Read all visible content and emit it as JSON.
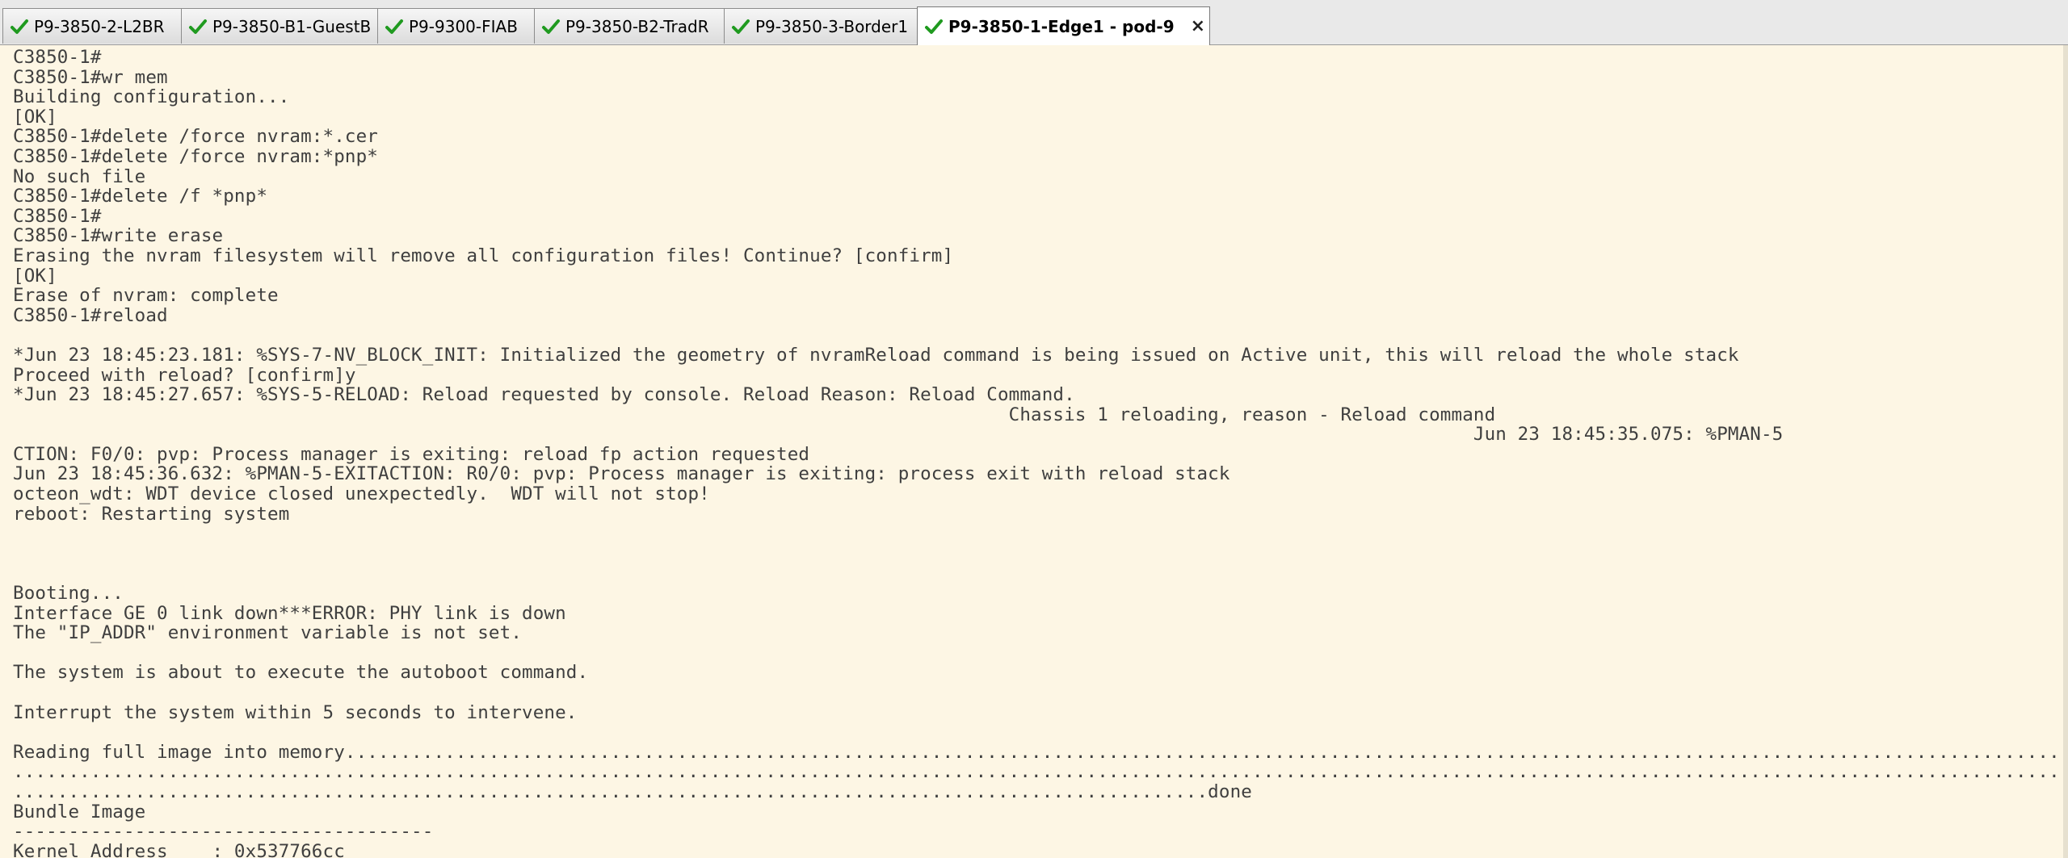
{
  "tabs": [
    {
      "label": "P9-3850-2-L2BR",
      "active": false
    },
    {
      "label": "P9-3850-B1-GuestB",
      "active": false
    },
    {
      "label": "P9-9300-FIAB",
      "active": false
    },
    {
      "label": "P9-3850-B2-TradR",
      "active": false
    },
    {
      "label": "P9-3850-3-Border1",
      "active": false
    },
    {
      "label": "P9-3850-1-Edge1 - pod-9",
      "active": true
    }
  ],
  "close_icon": "×",
  "colors": {
    "terminal_bg": "#fdf6e4",
    "terminal_text": "#3f3f3f",
    "check_green": "#1f9a1f"
  },
  "terminal": {
    "lines": [
      "C3850-1#",
      "C3850-1#wr mem",
      "Building configuration...",
      "[OK]",
      "C3850-1#delete /force nvram:*.cer",
      "C3850-1#delete /force nvram:*pnp*",
      "No such file",
      "C3850-1#delete /f *pnp*",
      "C3850-1#",
      "C3850-1#write erase",
      "Erasing the nvram filesystem will remove all configuration files! Continue? [confirm]",
      "[OK]",
      "Erase of nvram: complete",
      "C3850-1#reload",
      "",
      "*Jun 23 18:45:23.181: %SYS-7-NV_BLOCK_INIT: Initialized the geometry of nvramReload command is being issued on Active unit, this will reload the whole stack",
      "Proceed with reload? [confirm]y",
      "*Jun 23 18:45:27.657: %SYS-5-RELOAD: Reload requested by console. Reload Reason: Reload Command.",
      "                                                                                          Chassis 1 reloading, reason - Reload command",
      "                                                                                                                                    Jun 23 18:45:35.075: %PMAN-5",
      "CTION: F0/0: pvp: Process manager is exiting: reload fp action requested",
      "Jun 23 18:45:36.632: %PMAN-5-EXITACTION: R0/0: pvp: Process manager is exiting: process exit with reload stack",
      "octeon_wdt: WDT device closed unexpectedly.  WDT will not stop!",
      "reboot: Restarting system",
      "",
      "",
      "",
      "Booting...",
      "Interface GE 0 link down***ERROR: PHY link is down",
      "The \"IP_ADDR\" environment variable is not set.",
      "",
      "The system is about to execute the autoboot command.",
      "",
      "Interrupt the system within 5 seconds to intervene.",
      "",
      "Reading full image into memory.....................................................................................................................................................................",
      "..................................................................................................................................................................................................",
      "............................................................................................................done",
      "Bundle Image",
      "--------------------------------------",
      "Kernel Address    : 0x537766cc"
    ]
  }
}
